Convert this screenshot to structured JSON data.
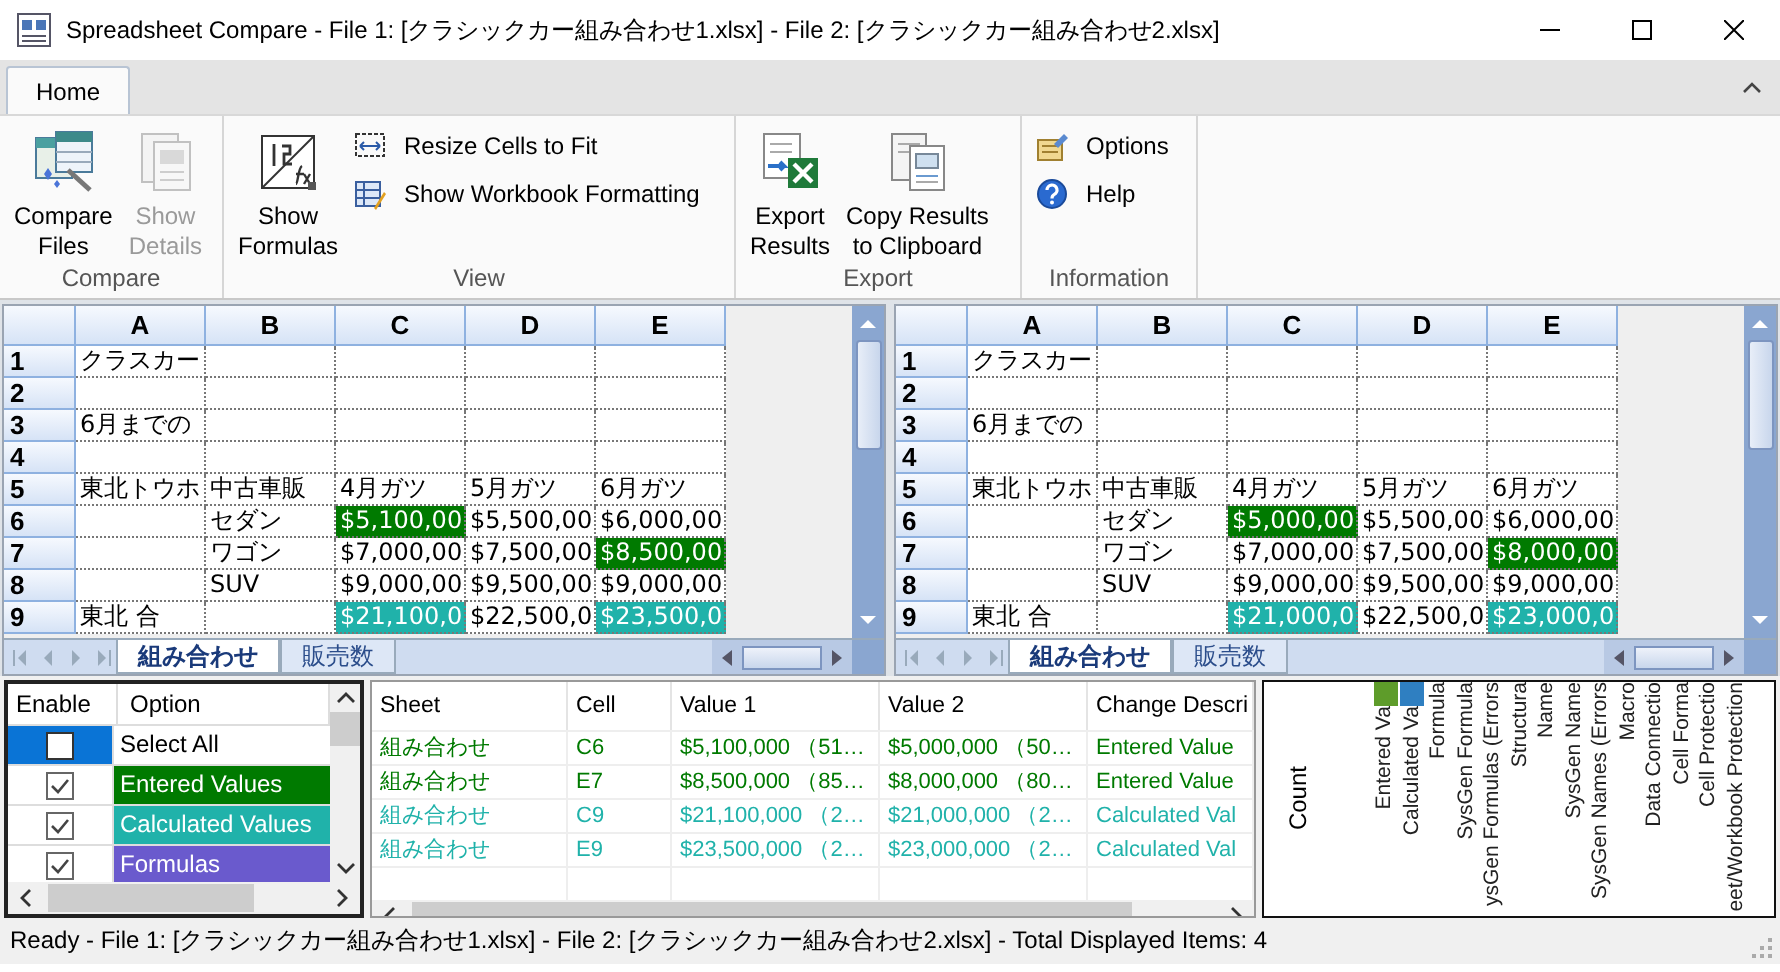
{
  "window": {
    "title": "Spreadsheet Compare - File 1: [クラシックカー組み合わせ1.xlsx] - File 2: [クラシックカー組み合わせ2.xlsx]"
  },
  "ribbon": {
    "tabs": [
      {
        "label": "Home",
        "selected": true
      }
    ],
    "groups": [
      {
        "label": "Compare",
        "items": [
          {
            "kind": "large",
            "lines": [
              "Compare",
              "Files"
            ],
            "disabled": false
          },
          {
            "kind": "large",
            "lines": [
              "Show",
              "Details"
            ],
            "disabled": true
          }
        ]
      },
      {
        "label": "View",
        "items": [
          {
            "kind": "large",
            "lines": [
              "Show",
              "Formulas"
            ],
            "disabled": false
          },
          {
            "kind": "small",
            "lines": [
              "Resize Cells to Fit"
            ],
            "disabled": false
          },
          {
            "kind": "small",
            "lines": [
              "Show Workbook Formatting"
            ],
            "disabled": false
          }
        ]
      },
      {
        "label": "Export",
        "items": [
          {
            "kind": "large",
            "lines": [
              "Export",
              "Results"
            ],
            "disabled": false
          },
          {
            "kind": "large",
            "lines": [
              "Copy Results",
              "to Clipboard"
            ],
            "disabled": false
          }
        ]
      },
      {
        "label": "Information",
        "items": [
          {
            "kind": "small",
            "lines": [
              "Options"
            ],
            "disabled": false
          },
          {
            "kind": "small",
            "lines": [
              "Help"
            ],
            "disabled": false
          }
        ]
      }
    ]
  },
  "panes": [
    {
      "columns": [
        "A",
        "B",
        "C",
        "D",
        "E"
      ],
      "rows": [
        {
          "header": "1",
          "cells": [
            {
              "text": "クラスカー"
            },
            {
              "text": ""
            },
            {
              "text": ""
            },
            {
              "text": ""
            },
            {
              "text": ""
            }
          ]
        },
        {
          "header": "2",
          "cells": [
            {
              "text": ""
            },
            {
              "text": ""
            },
            {
              "text": ""
            },
            {
              "text": ""
            },
            {
              "text": ""
            }
          ]
        },
        {
          "header": "3",
          "cells": [
            {
              "text": "6月までの"
            },
            {
              "text": ""
            },
            {
              "text": ""
            },
            {
              "text": ""
            },
            {
              "text": ""
            }
          ]
        },
        {
          "header": "4",
          "cells": [
            {
              "text": ""
            },
            {
              "text": ""
            },
            {
              "text": ""
            },
            {
              "text": ""
            },
            {
              "text": ""
            }
          ]
        },
        {
          "header": "5",
          "cells": [
            {
              "text": "東北トウホ"
            },
            {
              "text": "中古車販"
            },
            {
              "text": "4月ガツ"
            },
            {
              "text": "5月ガツ"
            },
            {
              "text": "6月ガツ"
            }
          ]
        },
        {
          "header": "6",
          "cells": [
            {
              "text": ""
            },
            {
              "text": "セダン"
            },
            {
              "text": "$5,100,00",
              "color": "#007a00"
            },
            {
              "text": "$5,500,00"
            },
            {
              "text": "$6,000,00"
            }
          ]
        },
        {
          "header": "7",
          "cells": [
            {
              "text": ""
            },
            {
              "text": "ワゴン"
            },
            {
              "text": "$7,000,00"
            },
            {
              "text": "$7,500,00"
            },
            {
              "text": "$8,500,00",
              "color": "#007a00"
            }
          ]
        },
        {
          "header": "8",
          "cells": [
            {
              "text": ""
            },
            {
              "text": "SUV"
            },
            {
              "text": "$9,000,00"
            },
            {
              "text": "$9,500,00"
            },
            {
              "text": "$9,000,00"
            }
          ]
        },
        {
          "header": "9",
          "cells": [
            {
              "text": "東北 合"
            },
            {
              "text": ""
            },
            {
              "text": "$21,100,0",
              "color": "#20b2aa"
            },
            {
              "text": "$22,500,0"
            },
            {
              "text": "$23,500,0",
              "color": "#20b2aa"
            }
          ]
        }
      ],
      "sheet_tabs": [
        {
          "label": "組み合わせ",
          "selected": true
        },
        {
          "label": "販売数",
          "selected": false
        }
      ]
    },
    {
      "columns": [
        "A",
        "B",
        "C",
        "D",
        "E"
      ],
      "rows": [
        {
          "header": "1",
          "cells": [
            {
              "text": "クラスカー"
            },
            {
              "text": ""
            },
            {
              "text": ""
            },
            {
              "text": ""
            },
            {
              "text": ""
            }
          ]
        },
        {
          "header": "2",
          "cells": [
            {
              "text": ""
            },
            {
              "text": ""
            },
            {
              "text": ""
            },
            {
              "text": ""
            },
            {
              "text": ""
            }
          ]
        },
        {
          "header": "3",
          "cells": [
            {
              "text": "6月までの"
            },
            {
              "text": ""
            },
            {
              "text": ""
            },
            {
              "text": ""
            },
            {
              "text": ""
            }
          ]
        },
        {
          "header": "4",
          "cells": [
            {
              "text": ""
            },
            {
              "text": ""
            },
            {
              "text": ""
            },
            {
              "text": ""
            },
            {
              "text": ""
            }
          ]
        },
        {
          "header": "5",
          "cells": [
            {
              "text": "東北トウホ"
            },
            {
              "text": "中古車販"
            },
            {
              "text": "4月ガツ"
            },
            {
              "text": "5月ガツ"
            },
            {
              "text": "6月ガツ"
            }
          ]
        },
        {
          "header": "6",
          "cells": [
            {
              "text": ""
            },
            {
              "text": "セダン"
            },
            {
              "text": "$5,000,00",
              "color": "#007a00"
            },
            {
              "text": "$5,500,00"
            },
            {
              "text": "$6,000,00"
            }
          ]
        },
        {
          "header": "7",
          "cells": [
            {
              "text": ""
            },
            {
              "text": "ワゴン"
            },
            {
              "text": "$7,000,00"
            },
            {
              "text": "$7,500,00"
            },
            {
              "text": "$8,000,00",
              "color": "#007a00"
            }
          ]
        },
        {
          "header": "8",
          "cells": [
            {
              "text": ""
            },
            {
              "text": "SUV"
            },
            {
              "text": "$9,000,00"
            },
            {
              "text": "$9,500,00"
            },
            {
              "text": "$9,000,00"
            }
          ]
        },
        {
          "header": "9",
          "cells": [
            {
              "text": "東北 合"
            },
            {
              "text": ""
            },
            {
              "text": "$21,000,0",
              "color": "#20b2aa"
            },
            {
              "text": "$22,500,0"
            },
            {
              "text": "$23,000,0",
              "color": "#20b2aa"
            }
          ]
        }
      ],
      "sheet_tabs": [
        {
          "label": "組み合わせ",
          "selected": true
        },
        {
          "label": "販売数",
          "selected": false
        }
      ]
    }
  ],
  "options": {
    "columns": [
      "Enable",
      "Option"
    ],
    "items": [
      {
        "label": "Select All",
        "checked": false,
        "selected": true
      },
      {
        "label": "Entered Values",
        "checked": true,
        "selected": false,
        "color": "#007a00"
      },
      {
        "label": "Calculated Values",
        "checked": true,
        "selected": false,
        "color": "#20b2aa"
      },
      {
        "label": "Formulas",
        "checked": true,
        "selected": false,
        "color": "#6a5acd"
      }
    ]
  },
  "results": {
    "columns": [
      "Sheet",
      "Cell",
      "Value 1",
      "Value 2",
      "Change Descri"
    ],
    "rows": [
      {
        "color": "#007a00",
        "cells": [
          "組み合わせ",
          "C6",
          "$5,100,000 （51…",
          "$5,000,000 （50…",
          "Entered Value"
        ]
      },
      {
        "color": "#007a00",
        "cells": [
          "組み合わせ",
          "E7",
          "$8,500,000 （85…",
          "$8,000,000 （80…",
          "Entered Value"
        ]
      },
      {
        "color": "#20b2aa",
        "cells": [
          "組み合わせ",
          "C9",
          "$21,100,000 （2…",
          "$21,000,000 （2…",
          "Calculated Val"
        ]
      },
      {
        "color": "#20b2aa",
        "cells": [
          "組み合わせ",
          "E9",
          "$23,500,000 （2…",
          "$23,000,000 （2…",
          "Calculated Val"
        ]
      }
    ]
  },
  "summary_chart": {
    "ylabel": "Count",
    "categories": [
      {
        "label": "Entered Va",
        "color": "#5e9c2a"
      },
      {
        "label": "Calculated Va",
        "color": "#2f7fc1"
      },
      {
        "label": "Formula"
      },
      {
        "label": "SysGen Formula"
      },
      {
        "label": "ysGen Formulas (Errors"
      },
      {
        "label": "Structura"
      },
      {
        "label": "Name"
      },
      {
        "label": "SysGen Name"
      },
      {
        "label": "SysGen Names (Errors"
      },
      {
        "label": "Macro"
      },
      {
        "label": "Data Connectio"
      },
      {
        "label": "Cell Forma"
      },
      {
        "label": "Cell Protectio"
      },
      {
        "label": "eet/Workbook Protection"
      }
    ]
  },
  "status_bar": "Ready - File 1: [クラシックカー組み合わせ1.xlsx] - File 2: [クラシックカー組み合わせ2.xlsx] - Total Displayed Items: 4"
}
